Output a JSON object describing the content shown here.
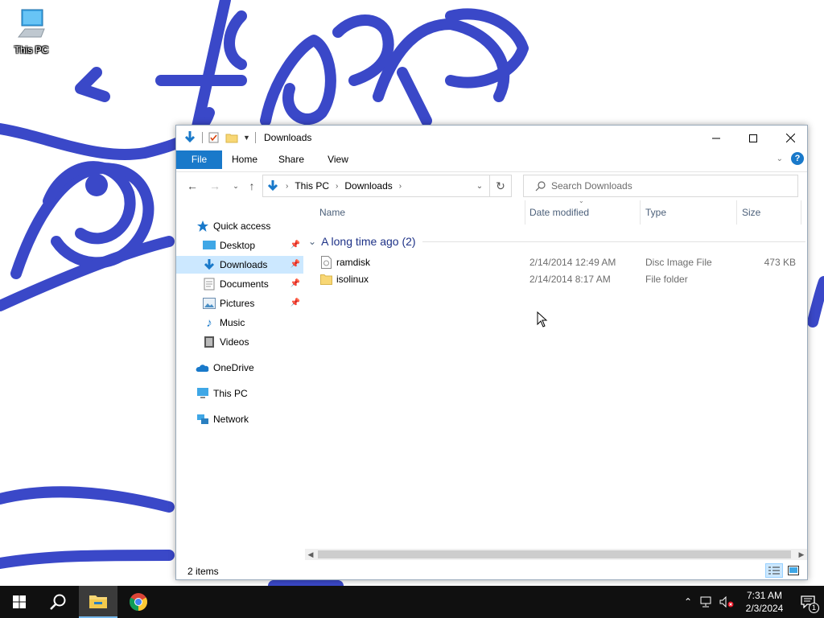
{
  "desktop": {
    "icons": [
      {
        "label": "This PC",
        "icon": "monitor-icon"
      }
    ]
  },
  "window": {
    "title": "Downloads",
    "ribbon_tabs": [
      "File",
      "Home",
      "Share",
      "View"
    ],
    "address": {
      "crumbs": [
        "This PC",
        "Downloads"
      ]
    },
    "search": {
      "placeholder": "Search Downloads"
    },
    "nav_pane": {
      "quick_access_label": "Quick access",
      "quick_items": [
        {
          "label": "Desktop",
          "icon": "desktop-icon",
          "pinned": true
        },
        {
          "label": "Downloads",
          "icon": "download-arrow-icon",
          "pinned": true,
          "selected": true
        },
        {
          "label": "Documents",
          "icon": "documents-icon",
          "pinned": true
        },
        {
          "label": "Pictures",
          "icon": "pictures-icon",
          "pinned": true
        },
        {
          "label": "Music",
          "icon": "music-note-icon",
          "pinned": false
        },
        {
          "label": "Videos",
          "icon": "film-icon",
          "pinned": false
        }
      ],
      "roots": [
        {
          "label": "OneDrive",
          "icon": "cloud-icon"
        },
        {
          "label": "This PC",
          "icon": "monitor-icon"
        },
        {
          "label": "Network",
          "icon": "network-icon"
        }
      ]
    },
    "columns": [
      "Name",
      "Date modified",
      "Type",
      "Size"
    ],
    "group": {
      "label": "A long time ago (2)"
    },
    "files": [
      {
        "name": "ramdisk",
        "date": "2/14/2014 12:49 AM",
        "type": "Disc Image File",
        "size": "473 KB",
        "icon": "disc-image-icon"
      },
      {
        "name": "isolinux",
        "date": "2/14/2014 8:17 AM",
        "type": "File folder",
        "size": "",
        "icon": "folder-icon"
      }
    ],
    "status": {
      "count": "2 items"
    }
  },
  "taskbar": {
    "clock": {
      "time": "7:31 AM",
      "date": "2/3/2024"
    },
    "notifications": "1"
  },
  "colors": {
    "accent": "#1979ca",
    "selection": "#cce8ff",
    "scribble": "#3a48c8",
    "taskbar": "#101010"
  }
}
